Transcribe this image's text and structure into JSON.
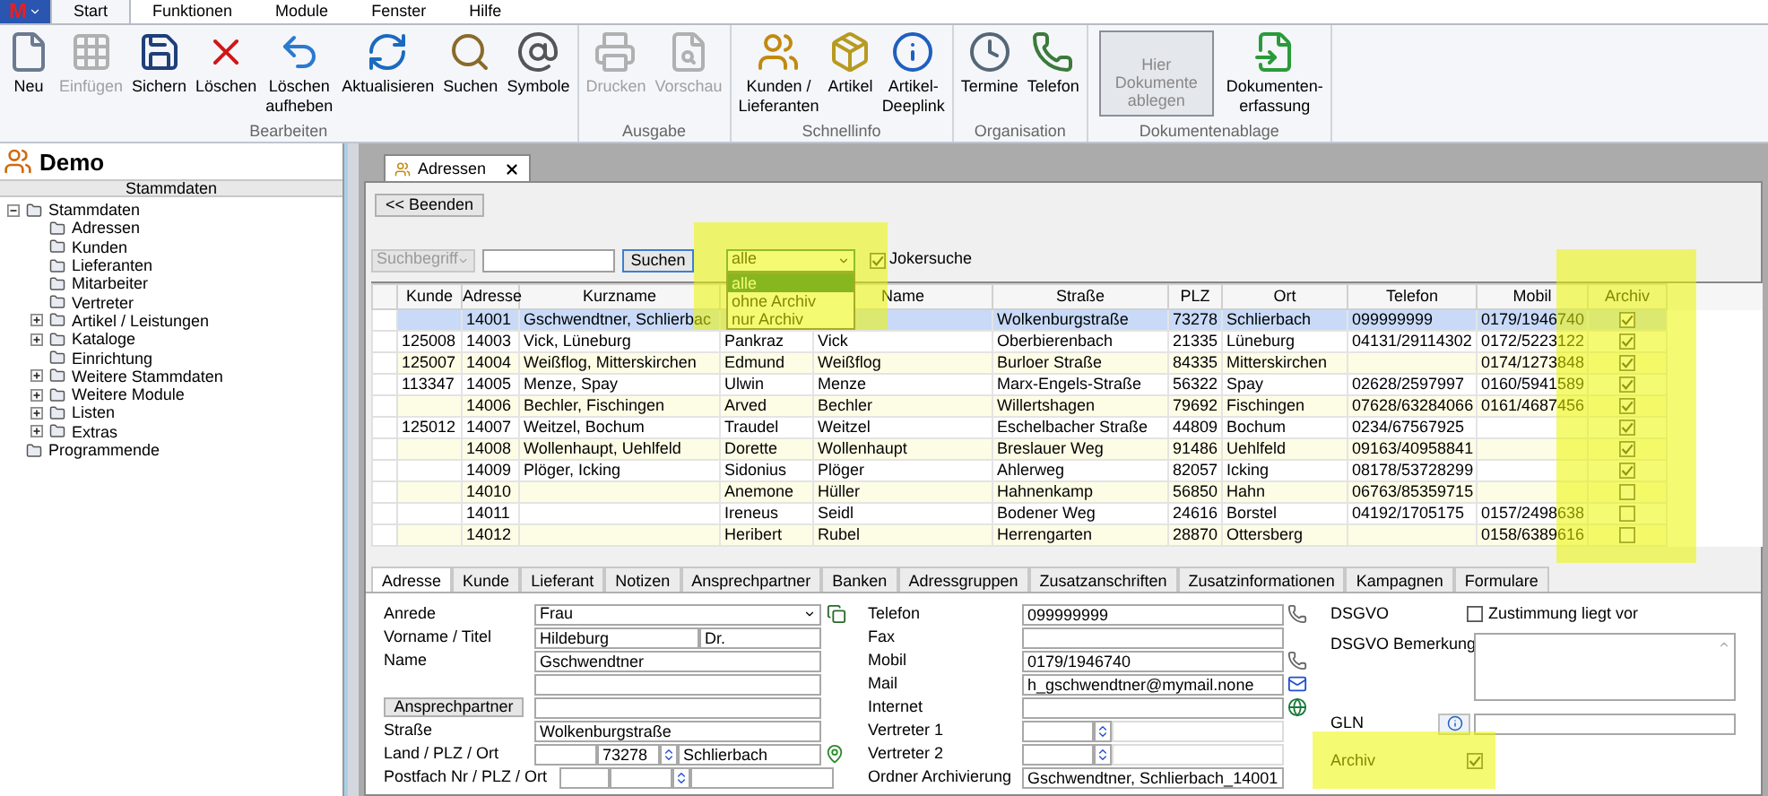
{
  "app_menu": {
    "logo": "M"
  },
  "ribbon": {
    "tabs": [
      {
        "label": "Start",
        "selected": true
      },
      {
        "label": "Funktionen",
        "selected": false
      },
      {
        "label": "Module",
        "selected": false
      },
      {
        "label": "Fenster",
        "selected": false
      },
      {
        "label": "Hilfe",
        "selected": false
      }
    ],
    "groups": [
      {
        "title": "Bearbeiten",
        "buttons": [
          {
            "kind": "button",
            "label": "Neu",
            "disabled": false
          },
          {
            "kind": "button",
            "label": "Einfügen",
            "disabled": true
          },
          {
            "kind": "button",
            "label": "Sichern",
            "disabled": false
          },
          {
            "kind": "button",
            "label": "Löschen",
            "disabled": false
          },
          {
            "kind": "button",
            "label": "Löschen\naufheben",
            "disabled": false
          },
          {
            "kind": "button",
            "label": "Aktualisieren",
            "disabled": false
          },
          {
            "kind": "button",
            "label": "Suchen",
            "disabled": false
          },
          {
            "kind": "button",
            "label": "Symbole",
            "disabled": false
          }
        ]
      },
      {
        "title": "Ausgabe",
        "buttons": [
          {
            "kind": "button",
            "label": "Drucken",
            "disabled": true
          },
          {
            "kind": "button",
            "label": "Vorschau",
            "disabled": true
          }
        ]
      },
      {
        "title": "Schnellinfo",
        "buttons": [
          {
            "kind": "button",
            "label": "Kunden /\nLieferanten",
            "disabled": false
          },
          {
            "kind": "button",
            "label": "Artikel",
            "disabled": false
          },
          {
            "kind": "button",
            "label": "Artikel-\nDeeplink",
            "disabled": false
          }
        ]
      },
      {
        "title": "Organisation",
        "buttons": [
          {
            "kind": "button",
            "label": "Termine",
            "disabled": false
          },
          {
            "kind": "button",
            "label": "Telefon",
            "disabled": false
          }
        ]
      },
      {
        "title": "Dokumentenablage",
        "buttons": [
          {
            "kind": "dropzone",
            "label": "Hier Dokumente ablegen"
          },
          {
            "kind": "button",
            "label": "Dokumenten-\nerfassung",
            "disabled": false
          }
        ]
      }
    ]
  },
  "sidebar": {
    "title": "Demo",
    "section": "Stammdaten",
    "tree": [
      {
        "label": "Stammdaten",
        "expanded": true,
        "children": [
          {
            "label": "Adressen"
          },
          {
            "label": "Kunden"
          },
          {
            "label": "Lieferanten"
          },
          {
            "label": "Mitarbeiter"
          },
          {
            "label": "Vertreter"
          },
          {
            "label": "Artikel / Leistungen",
            "expanded": false
          },
          {
            "label": "Kataloge",
            "expanded": false
          },
          {
            "label": "Einrichtung"
          },
          {
            "label": "Weitere Stammdaten",
            "expanded": false
          },
          {
            "label": "Weitere Module",
            "expanded": false
          },
          {
            "label": "Listen",
            "expanded": false
          },
          {
            "label": "Extras",
            "expanded": false
          }
        ]
      },
      {
        "label": "Programmende"
      }
    ]
  },
  "document_tab": {
    "label": "Adressen"
  },
  "toolbar": {
    "back_button": "<< Beenden",
    "search_type": {
      "value": "Suchbegriff",
      "disabled": true
    },
    "search_button": "Suchen",
    "filter": {
      "value": "alle",
      "options": [
        {
          "label": "alle",
          "selected": true
        },
        {
          "label": "ohne Archiv",
          "selected": false
        },
        {
          "label": "nur Archiv",
          "selected": false
        }
      ]
    },
    "wildcard": {
      "label": "Jokersuche",
      "checked": true
    }
  },
  "table": {
    "columns": [
      "Kunde",
      "Adresse",
      "Kurzname",
      null,
      "Name",
      "Straße",
      "PLZ",
      "Ort",
      "Telefon",
      "Mobil",
      "Archiv"
    ],
    "rows": [
      {
        "cells": [
          null,
          "14001",
          "Gschwendtner, Schlierbac",
          null,
          null,
          "Wolkenburgstraße",
          "73278",
          "Schlierbach",
          "099999999",
          "0179/1946740"
        ],
        "archived": true,
        "selected": true
      },
      {
        "cells": [
          "125008",
          "14003",
          "Vick, Lüneburg",
          "Pankraz",
          "Vick",
          "Oberbierenbach",
          "21335",
          "Lüneburg",
          "04131/29114302",
          "0172/5223122"
        ],
        "archived": true,
        "selected": false
      },
      {
        "cells": [
          "125007",
          "14004",
          "Weißflog, Mitterskirchen",
          "Edmund",
          "Weißflog",
          "Burloer Straße",
          "84335",
          "Mitterskirchen",
          null,
          "0174/1273848"
        ],
        "archived": true,
        "selected": false
      },
      {
        "cells": [
          "113347",
          "14005",
          "Menze, Spay",
          "Ulwin",
          "Menze",
          "Marx-Engels-Straße",
          "56322",
          "Spay",
          "02628/2597997",
          "0160/5941589"
        ],
        "archived": true,
        "selected": false
      },
      {
        "cells": [
          null,
          "14006",
          "Bechler, Fischingen",
          "Arved",
          "Bechler",
          "Willertshagen",
          "79692",
          "Fischingen",
          "07628/63284066",
          "0161/4687456"
        ],
        "archived": true,
        "selected": false
      },
      {
        "cells": [
          "125012",
          "14007",
          "Weitzel, Bochum",
          "Traudel",
          "Weitzel",
          "Eschelbacher Straße",
          "44809",
          "Bochum",
          "0234/67567925",
          null
        ],
        "archived": true,
        "selected": false
      },
      {
        "cells": [
          null,
          "14008",
          "Wollenhaupt, Uehlfeld",
          "Dorette",
          "Wollenhaupt",
          "Breslauer Weg",
          "91486",
          "Uehlfeld",
          "09163/40958841",
          null
        ],
        "archived": true,
        "selected": false
      },
      {
        "cells": [
          null,
          "14009",
          "Plöger, Icking",
          "Sidonius",
          "Plöger",
          "Ahlerweg",
          "82057",
          "Icking",
          "08178/53728299",
          null
        ],
        "archived": true,
        "selected": false
      },
      {
        "cells": [
          null,
          "14010",
          null,
          "Anemone",
          "Hüller",
          "Hahnenkamp",
          "56850",
          "Hahn",
          "06763/85359715",
          null
        ],
        "archived": false,
        "selected": false
      },
      {
        "cells": [
          null,
          "14011",
          null,
          "Ireneus",
          "Seidl",
          "Bodener Weg",
          "24616",
          "Borstel",
          "04192/1705175",
          "0157/2498638"
        ],
        "archived": false,
        "selected": false
      },
      {
        "cells": [
          null,
          "14012",
          null,
          "Heribert",
          "Rubel",
          "Herrengarten",
          "28870",
          "Ottersberg",
          null,
          "0158/6389616"
        ],
        "archived": false,
        "selected": false
      }
    ]
  },
  "detail_tabs": [
    {
      "label": "Adresse",
      "selected": true
    },
    {
      "label": "Kunde",
      "selected": false
    },
    {
      "label": "Lieferant",
      "selected": false
    },
    {
      "label": "Notizen",
      "selected": false
    },
    {
      "label": "Ansprechpartner",
      "selected": false
    },
    {
      "label": "Banken",
      "selected": false
    },
    {
      "label": "Adressgruppen",
      "selected": false
    },
    {
      "label": "Zusatzanschriften",
      "selected": false
    },
    {
      "label": "Zusatzinformationen",
      "selected": false
    },
    {
      "label": "Kampagnen",
      "selected": false
    },
    {
      "label": "Formulare",
      "selected": false
    }
  ],
  "address_form": {
    "salutation": {
      "label": "Anrede",
      "value": "Frau"
    },
    "first_name_title": {
      "label": "Vorname / Titel",
      "first_name": "Hildeburg",
      "title": "Dr."
    },
    "name": {
      "label": "Name",
      "value": "Gschwendtner"
    },
    "contact_button": "Ansprechpartner",
    "street": {
      "label": "Straße",
      "value": "Wolkenburgstraße"
    },
    "country_zip_city": {
      "label": "Land / PLZ / Ort",
      "zip": "73278",
      "city": "Schlierbach"
    },
    "po_box": {
      "label": "Postfach Nr / PLZ / Ort"
    },
    "contact_fields": [
      {
        "kind": "phone",
        "label": "Telefon",
        "value": "099999999"
      },
      {
        "kind": "plain",
        "label": "Fax"
      },
      {
        "kind": "phone",
        "label": "Mobil",
        "value": "0179/1946740"
      },
      {
        "kind": "mail",
        "label": "Mail",
        "value": "h_gschwendtner@mymail.none"
      },
      {
        "kind": "web",
        "label": "Internet"
      },
      {
        "kind": "lookup",
        "label": "Vertreter 1"
      },
      {
        "kind": "lookup",
        "label": "Vertreter 2"
      },
      {
        "kind": "plain",
        "label": "Ordner Archivierung",
        "value": "Gschwendtner, Schlierbach_14001"
      }
    ],
    "dsgvo": {
      "label": "DSGVO",
      "consent_label": "Zustimmung liegt vor",
      "checked": false
    },
    "dsgvo_note": {
      "label": "DSGVO Bemerkung"
    },
    "gln": {
      "label": "GLN"
    },
    "archive": {
      "label": "Archiv",
      "checked": true
    }
  }
}
